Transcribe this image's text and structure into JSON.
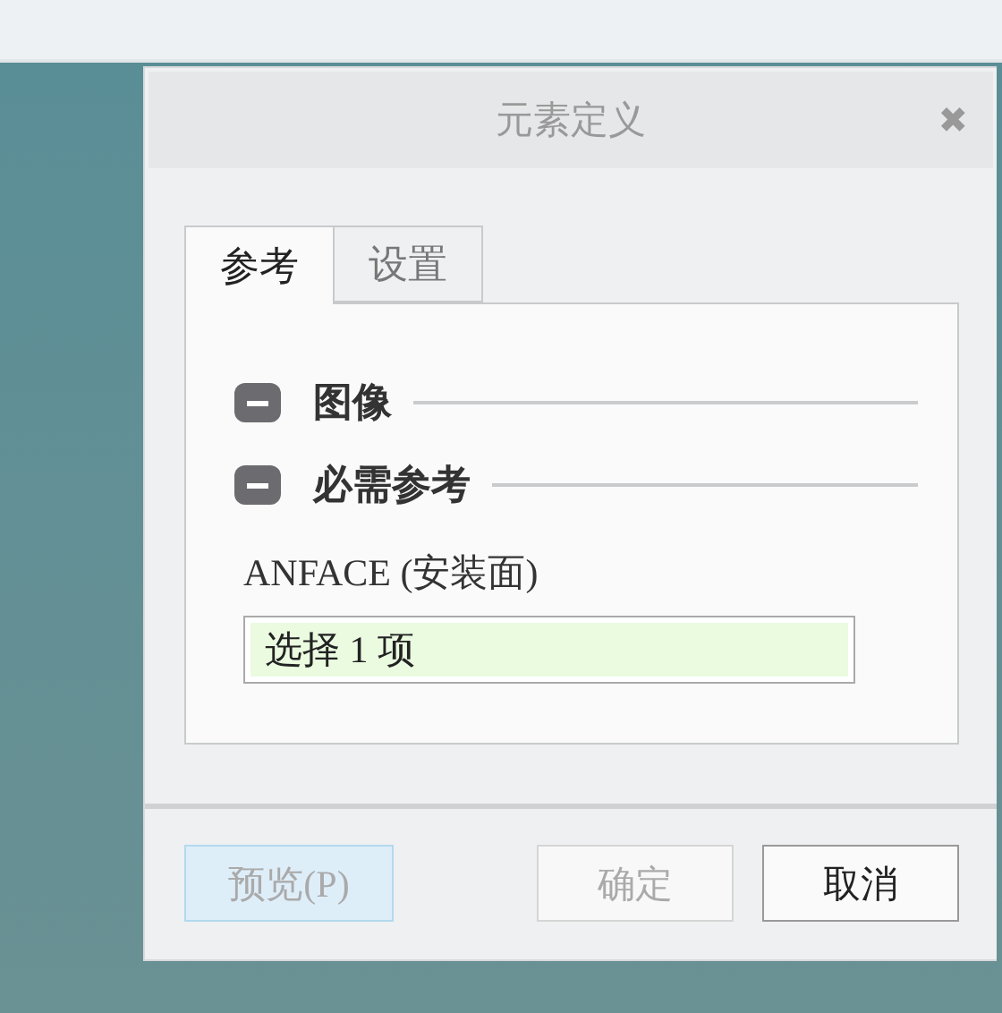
{
  "dialog": {
    "title": "元素定义",
    "close": "✖"
  },
  "tabs": [
    {
      "label": "参考",
      "selected": true
    },
    {
      "label": "设置",
      "selected": false
    }
  ],
  "sections": [
    {
      "title": "图像",
      "expanded": true
    },
    {
      "title": "必需参考",
      "expanded": true
    }
  ],
  "collector": {
    "label": "ANFACE (安装面)",
    "value": "选择 1 项",
    "active": true
  },
  "buttons": [
    {
      "label": "预览(P)",
      "kind": "preview",
      "disabled": true
    },
    {
      "label": "确定",
      "kind": "ok",
      "disabled": true
    },
    {
      "label": "取消",
      "kind": "cancel",
      "disabled": false
    }
  ]
}
